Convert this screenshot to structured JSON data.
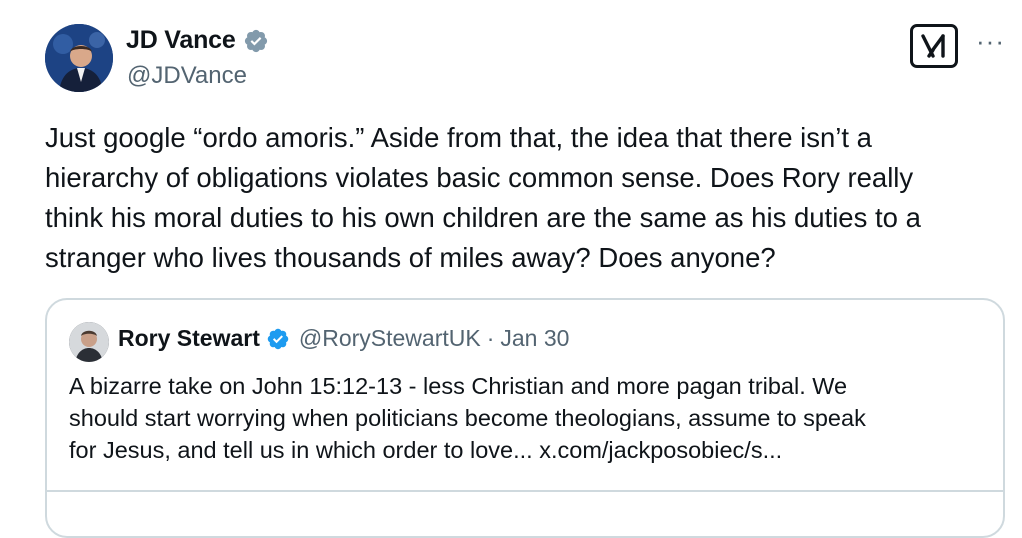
{
  "author": {
    "name": "JD Vance",
    "handle": "@JDVance",
    "verified_color": "#829aab"
  },
  "actions": {
    "grok_icon": "grok-icon",
    "more_label": "···"
  },
  "tweet": {
    "text": "Just google “ordo amoris.” Aside from that, the idea that there isn’t a\nhierarchy of obligations violates basic common sense. Does Rory really\nthink his moral duties to his own children are the same as his duties to a\nstranger who lives thousands of miles away? Does anyone?"
  },
  "quote": {
    "name": "Rory Stewart",
    "handle": "@RoryStewartUK",
    "separator": "·",
    "date": "Jan 30",
    "verified_color": "#1d9bf0",
    "text": "A bizarre take on John 15:12-13  - less Christian and more pagan tribal. We\nshould start worrying when politicians become theologians, assume to speak\nfor Jesus, and tell us in which order to love... x.com/jackposobiec/s..."
  }
}
